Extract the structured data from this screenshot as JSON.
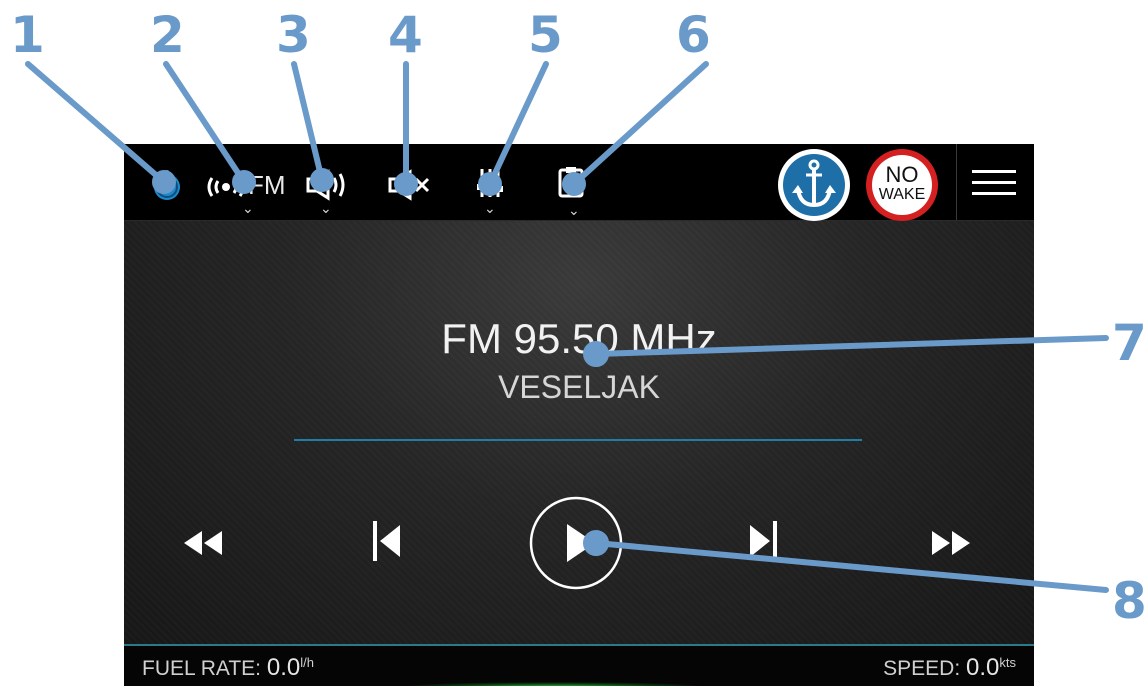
{
  "callouts": [
    "1",
    "2",
    "3",
    "4",
    "5",
    "6",
    "7",
    "8"
  ],
  "topbar": {
    "source_label": "FM",
    "icons": [
      "power-icon",
      "radio-source-icon",
      "speaker-zone-icon",
      "mute-icon",
      "equalizer-icon",
      "device-icon"
    ],
    "anchor_badge_icon": "anchor-icon",
    "no_wake_line1": "NO",
    "no_wake_line2": "WAKE",
    "menu_icon": "hamburger-menu-icon"
  },
  "player": {
    "frequency": "FM 95.50 MHz",
    "station": "VESELJAK",
    "controls": [
      "rewind-icon",
      "previous-track-icon",
      "play-icon",
      "next-track-icon",
      "fast-forward-icon"
    ]
  },
  "status": {
    "fuel_label": "FUEL RATE:",
    "fuel_value": "0.0",
    "fuel_unit": "l/h",
    "speed_label": "SPEED:",
    "speed_value": "0.0",
    "speed_unit": "kts"
  },
  "colors": {
    "accent": "#1e88c8",
    "callout": "#6a9ac9",
    "no_wake_red": "#d42020",
    "progress": "#1f7ea3"
  }
}
